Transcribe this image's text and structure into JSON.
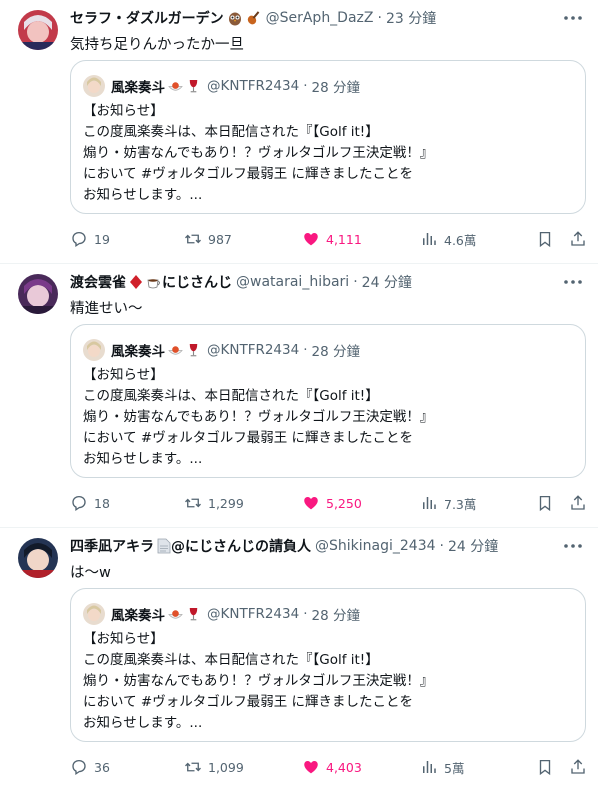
{
  "tweets": [
    {
      "name": "セラフ・ダズルガーデン",
      "emojis": [
        "owl",
        "violin"
      ],
      "handle": "@SerAph_DazZ",
      "dot": "·",
      "time": "23 分鐘",
      "text": "気持ち足りんかったか一旦",
      "avatar_colors": [
        "#c23a4a",
        "#f2c3c0"
      ],
      "quote": {
        "name": "風楽奏斗",
        "emojis": [
          "pasta",
          "wine"
        ],
        "handle": "@KNTFR2434",
        "dot": "·",
        "time": "28 分鐘",
        "lines": [
          "【お知らせ】",
          "この度風楽奏斗は、本日配信された『【Golf it!】",
          "煽り・妨害なんでもあり！？ヴォルタゴルフ王決定戦！』",
          "において #ヴォルタゴルフ最弱王 に輝きましたことを",
          "お知らせします。..."
        ]
      },
      "stats": {
        "replies": "19",
        "retweets": "987",
        "likes": "4,111",
        "views": "4.6萬"
      }
    },
    {
      "name": "渡会雲雀",
      "emojis": [
        "diamond",
        "coffee"
      ],
      "name_suffix": "にじさんじ",
      "handle": "@watarai_hibari",
      "dot": "·",
      "time": "24 分鐘",
      "text": "精進せい〜",
      "avatar_colors": [
        "#5a2a6a",
        "#e9c9d8"
      ],
      "quote": {
        "name": "風楽奏斗",
        "emojis": [
          "pasta",
          "wine"
        ],
        "handle": "@KNTFR2434",
        "dot": "·",
        "time": "28 分鐘",
        "lines": [
          "【お知らせ】",
          "この度風楽奏斗は、本日配信された『【Golf it!】",
          "煽り・妨害なんでもあり！？ヴォルタゴルフ王決定戦！』",
          "において #ヴォルタゴルフ最弱王 に輝きましたことを",
          "お知らせします。..."
        ]
      },
      "stats": {
        "replies": "18",
        "retweets": "1,299",
        "likes": "5,250",
        "views": "7.3萬"
      }
    },
    {
      "name": "四季凪アキラ",
      "emojis": [
        "document"
      ],
      "name_suffix": "@にじさんじの請負人",
      "handle": "@Shikinagi_2434",
      "dot": "·",
      "time": "24 分鐘",
      "text": "は〜w",
      "avatar_colors": [
        "#1a2a4a",
        "#f0d6c8"
      ],
      "quote": {
        "name": "風楽奏斗",
        "emojis": [
          "pasta",
          "wine"
        ],
        "handle": "@KNTFR2434",
        "dot": "·",
        "time": "28 分鐘",
        "lines": [
          "【お知らせ】",
          "この度風楽奏斗は、本日配信された『【Golf it!】",
          "煽り・妨害なんでもあり！？ヴォルタゴルフ王決定戦！』",
          "において #ヴォルタゴルフ最弱王 に輝きましたことを",
          "お知らせします。..."
        ]
      },
      "stats": {
        "replies": "36",
        "retweets": "1,099",
        "likes": "4,403",
        "views": "5萬"
      }
    }
  ],
  "colors": {
    "like": "#f91880",
    "muted": "#536471",
    "text": "#0f1419",
    "border": "#cfd9de"
  }
}
